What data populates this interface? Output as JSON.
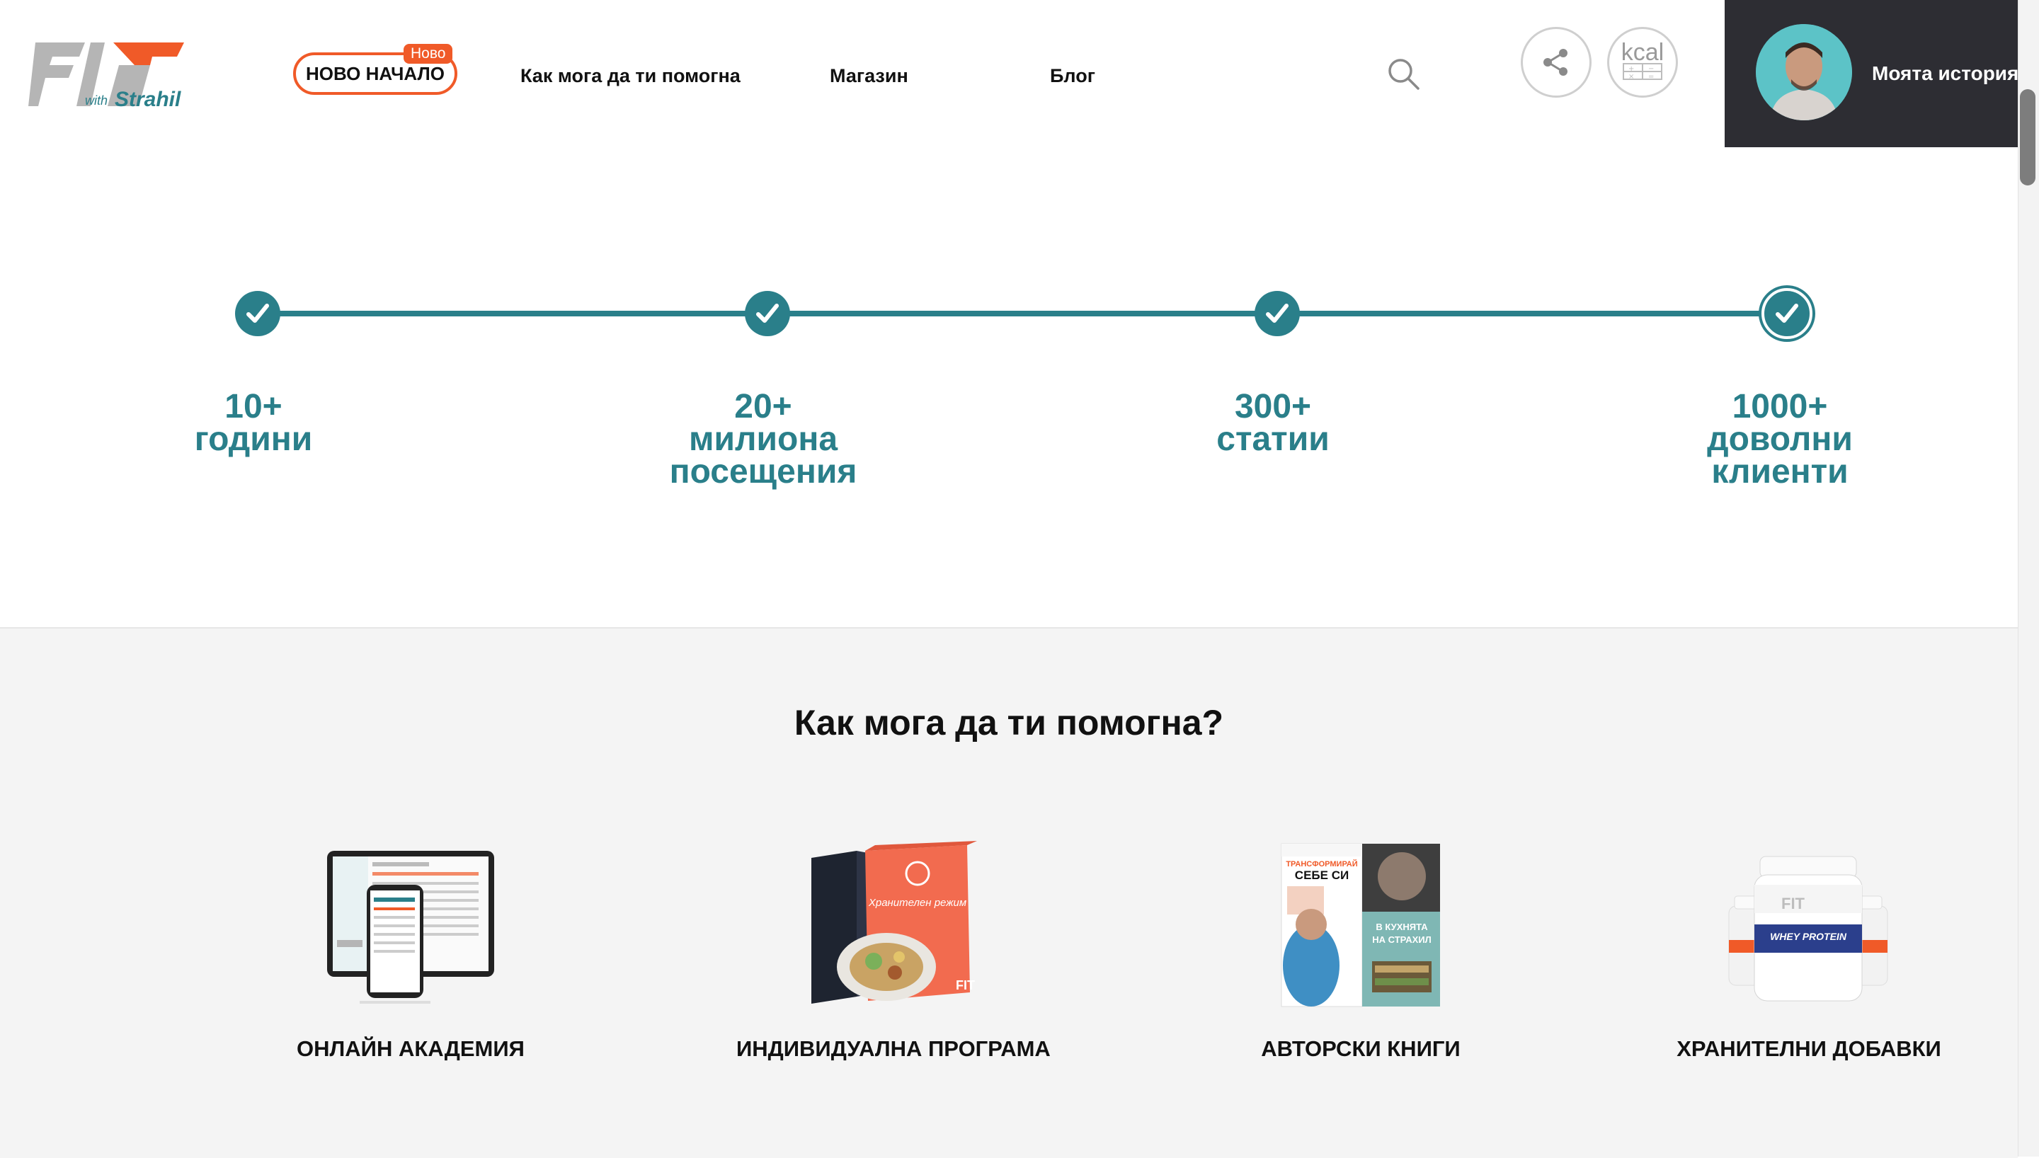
{
  "header": {
    "logo_text": "FIT",
    "logo_sub": "with Strahil",
    "nav": {
      "new_start": "НОВО НАЧАЛО",
      "new_badge": "Ново",
      "help": "Как мога да ти помогна",
      "shop": "Магазин",
      "blog": "Блог"
    },
    "kcal_label": "kcal",
    "story_label": "Моята история"
  },
  "stats": [
    {
      "line1": "10+",
      "line2": "години",
      "line3": ""
    },
    {
      "line1": "20+",
      "line2": "милиона",
      "line3": "посещения"
    },
    {
      "line1": "300+",
      "line2": "статии",
      "line3": ""
    },
    {
      "line1": "1000+",
      "line2": "доволни",
      "line3": "клиенти"
    }
  ],
  "help": {
    "title": "Как мога да ти помогна?",
    "products": [
      {
        "label": "ОНЛАЙН АКАДЕМИЯ"
      },
      {
        "label": "ИНДИВИДУАЛНА ПРОГРАМА",
        "box_text": "Хранителен режим"
      },
      {
        "label": "АВТОРСКИ КНИГИ",
        "book1": "ТРАНСФОРМИРАЙ СЕБЕ СИ",
        "book2": "В КУХНЯТА НА СТРАХИЛ"
      },
      {
        "label": "ХРАНИТЕЛНИ ДОБАВКИ",
        "jar_text": "WHEY PROTEIN"
      }
    ]
  },
  "colors": {
    "accent_orange": "#f05a28",
    "teal": "#2a7f8a",
    "dark_panel": "#2d2d33",
    "section_bg": "#f4f4f4"
  }
}
